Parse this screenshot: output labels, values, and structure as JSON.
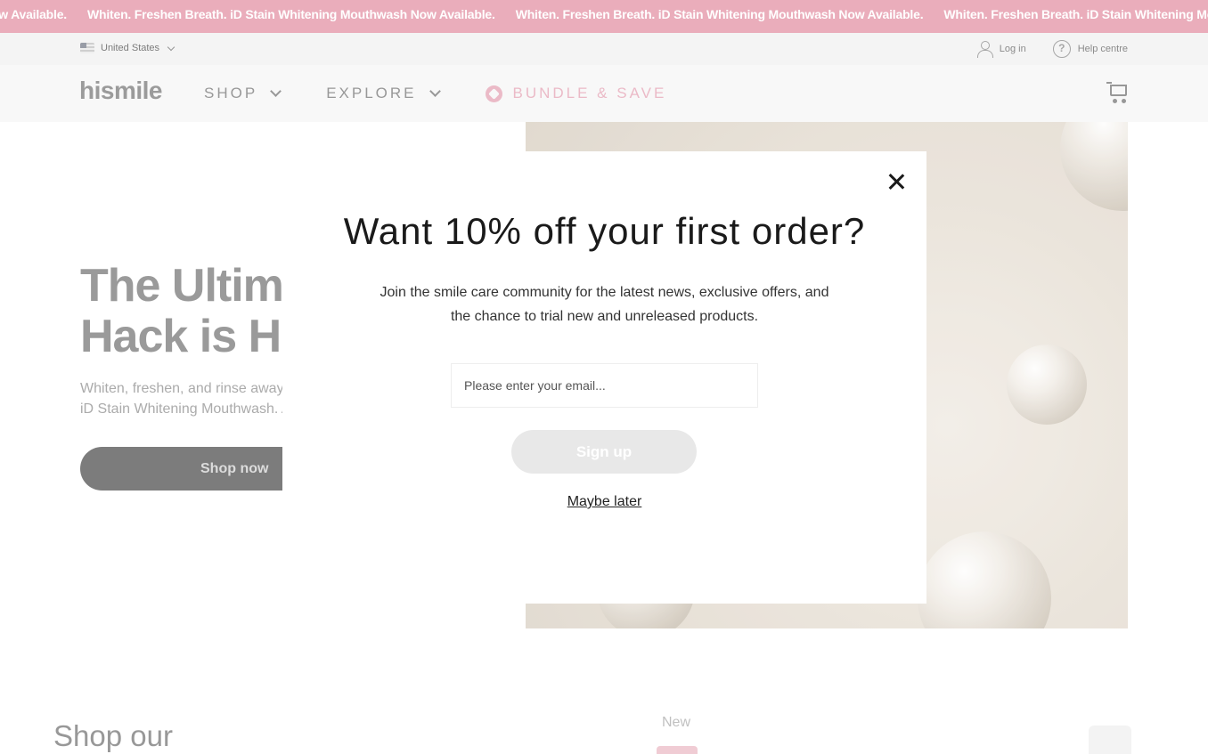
{
  "ticker": {
    "items": [
      "Now Available.",
      "Whiten. Freshen Breath. iD Stain Whitening Mouthwash Now Available.",
      "Whiten. Freshen Breath. iD Stain Whitening Mouthwash Now Available.",
      "Whiten. Freshen Breath. iD Stain Whitening Mouthwash"
    ],
    "color": "#e7a2b2"
  },
  "utility": {
    "country": "United States",
    "login": "Log in",
    "help": "Help centre"
  },
  "header": {
    "logo": "hismile",
    "nav": [
      {
        "label": "SHOP"
      },
      {
        "label": "EXPLORE"
      }
    ],
    "bundle": "BUNDLE & SAVE",
    "cart_icon": "cart-icon"
  },
  "hero": {
    "title_line1": "The Ultimate",
    "title_line2": "Hack is Here",
    "subtitle_line1": "Whiten, freshen, and rinse away g",
    "subtitle_line2": "iD Stain Whitening Mouthwash. A",
    "cta": "Shop now"
  },
  "below": {
    "shop_our": "Shop our",
    "new_badge": "New"
  },
  "modal": {
    "title": "Want 10% off your first order?",
    "text": "Join the smile care community for the latest news, exclusive offers, and the chance to trial new and unreleased products.",
    "email_placeholder": "Please enter your email...",
    "email_value": "",
    "signup": "Sign up",
    "maybe_later": "Maybe later"
  }
}
